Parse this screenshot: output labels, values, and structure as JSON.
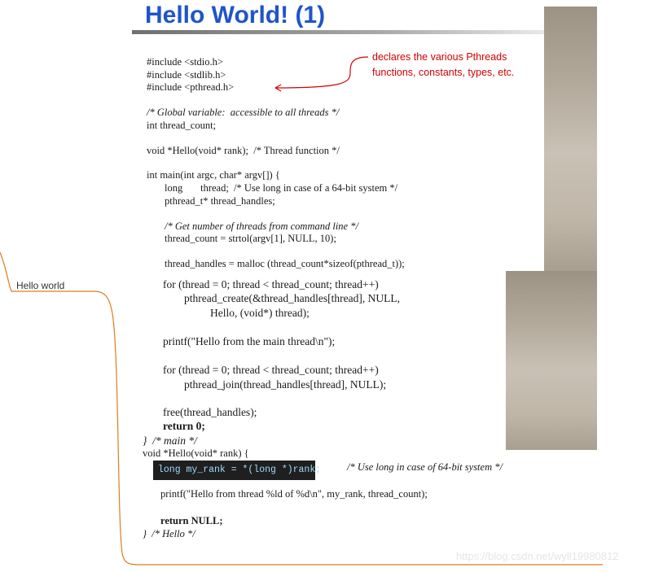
{
  "mindmap": {
    "node_label": "Hello world"
  },
  "slide": {
    "title": "Hello World! (1)",
    "annotation_lines": [
      "declares the various Pthreads",
      "functions, constants, types, etc."
    ],
    "code_top": [
      "#include <stdio.h>",
      "#include <stdlib.h>",
      "#include <pthread.h>",
      "/* Global variable:  accessible to all threads */",
      "int thread_count;",
      "void *Hello(void* rank);  /* Thread function */",
      "int main(int argc, char* argv[]) {",
      "long       thread;  /* Use long in case of a 64-bit system */",
      "pthread_t* thread_handles;",
      "/* Get number of threads from command line */",
      "thread_count = strtol(argv[1], NULL, 10);",
      "thread_handles = malloc (thread_count*sizeof(pthread_t));"
    ],
    "code_middle": [
      "for (thread = 0; thread < thread_count; thread++)",
      "pthread_create(&thread_handles[thread], NULL,",
      "Hello, (void*) thread);",
      "printf(\"Hello from the main thread\\n\");",
      "for (thread = 0; thread < thread_count; thread++)",
      "pthread_join(thread_handles[thread], NULL);",
      "free(thread_handles);",
      "return 0;",
      "}  /* main */"
    ],
    "code_bottom": [
      "void *Hello(void* rank) {",
      "/* Use long in case of 64-bit system */",
      "printf(\"Hello from thread %ld of %d\\n\", my_rank, thread_count);",
      "return NULL;",
      "}  /* Hello */"
    ]
  },
  "tooltip": {
    "text": "long my_rank = *(long *)rank;"
  },
  "watermark": "https://blog.csdn.net/wyll19980812",
  "colors": {
    "title": "#1f55c9",
    "annotation": "#d40000",
    "branch": "#e07b20",
    "tooltip_bg": "#1f1f1f"
  }
}
